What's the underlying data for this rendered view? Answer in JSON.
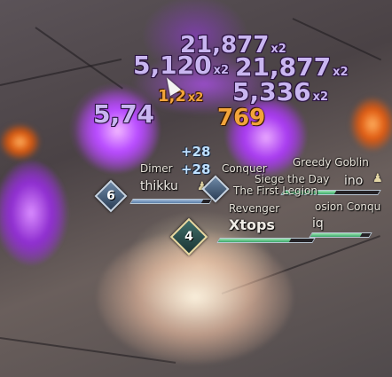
{
  "damage_numbers": [
    {
      "value": "21,877",
      "mult": "x2"
    },
    {
      "value": "5,120",
      "mult": "x2"
    },
    {
      "value": "21,877",
      "mult": "x2"
    },
    {
      "value": "5,336",
      "mult": "x2"
    },
    {
      "value": "5,74",
      "mult": ""
    },
    {
      "value": "769",
      "mult": ""
    },
    {
      "value": "1,2",
      "mult": "x2"
    }
  ],
  "heals": [
    "+28",
    "+28"
  ],
  "players": [
    {
      "guild": "Dimer",
      "name": "thikku",
      "level": "6"
    },
    {
      "guild": "Conquer",
      "name": "",
      "level": ""
    },
    {
      "guild": "Greedy Goblin",
      "name": "",
      "level": ""
    },
    {
      "guild": "Siege the Day",
      "name": "ino",
      "level": ""
    },
    {
      "guild": "The First Legion",
      "name": "",
      "level": ""
    },
    {
      "guild": "osion Conqu",
      "name": "iq",
      "level": ""
    },
    {
      "guild": "Revenger",
      "name": "Xtops",
      "level": "4"
    }
  ],
  "health": {
    "thikku": 0.9,
    "ino": 0.55,
    "iq": 0.85,
    "xtops": 0.75
  },
  "colors": {
    "damage": "#c9b6f0",
    "crit": "#f2a43a",
    "heal": "#bfe0ff",
    "hp_blue": "#5b7ea8",
    "hp_green": "#3aa66a"
  },
  "icons": [
    "cursor-arrow-icon",
    "party-member-icon",
    "level-diamond-icon"
  ]
}
